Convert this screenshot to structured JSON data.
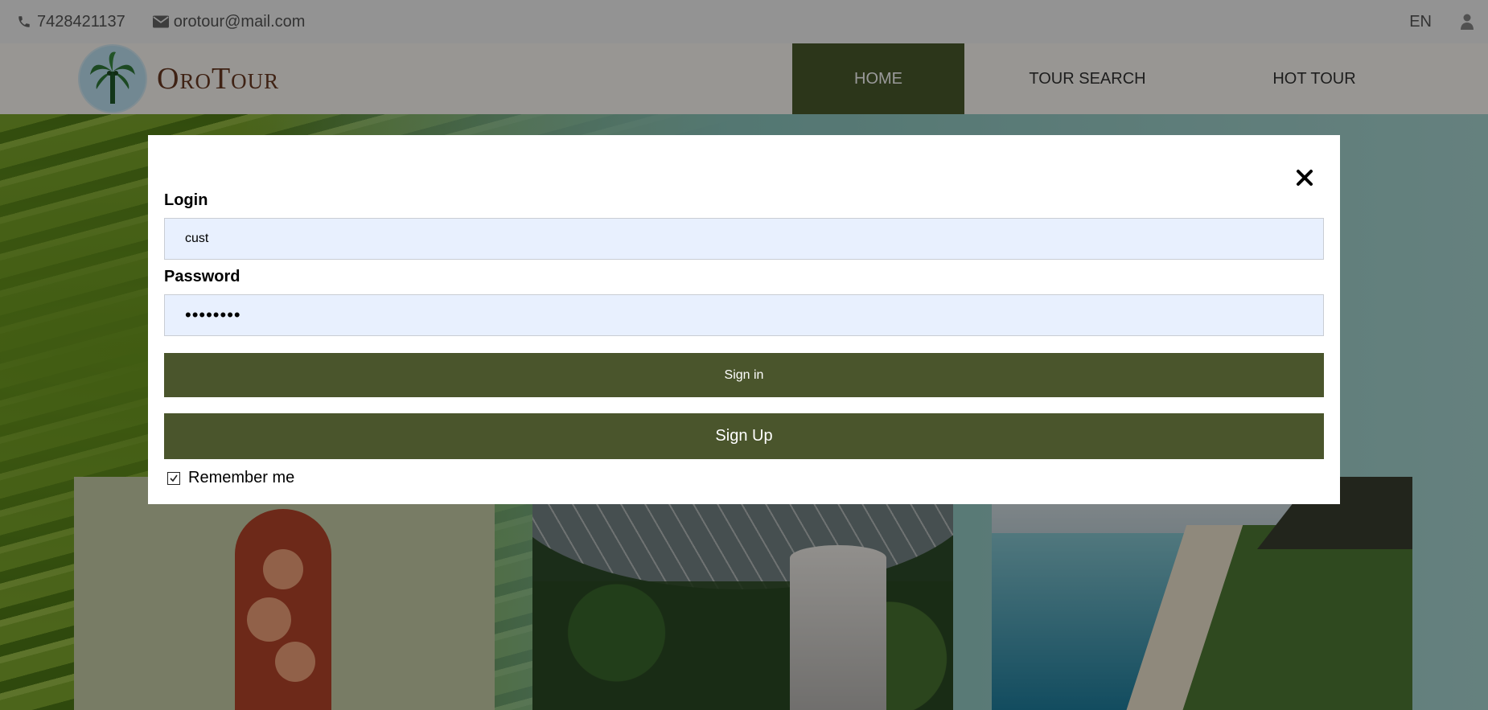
{
  "topbar": {
    "phone": "7428421137",
    "email": "orotour@mail.com",
    "language": "EN",
    "icons": {
      "phone": "phone-icon",
      "email": "envelope-icon",
      "user": "user-icon"
    }
  },
  "brand": {
    "name": "OroTour",
    "logo_icon": "palm-tree-icon"
  },
  "nav": {
    "items": [
      {
        "label": "HOME",
        "active": true
      },
      {
        "label": "TOUR SEARCH",
        "active": false
      },
      {
        "label": "HOT TOUR",
        "active": false
      }
    ]
  },
  "modal": {
    "close_icon": "close-icon",
    "login_label": "Login",
    "login_value": "cust",
    "password_label": "Password",
    "password_value": "••••••••",
    "sign_in_label": "Sign in",
    "sign_up_label": "Sign Up",
    "remember_label": "Remember me",
    "remember_checked": true
  },
  "colors": {
    "accent": "#4a552c",
    "nav_active": "#4a5a2c",
    "input_bg": "#e8f0fe",
    "brand_text": "#6a3a22"
  }
}
